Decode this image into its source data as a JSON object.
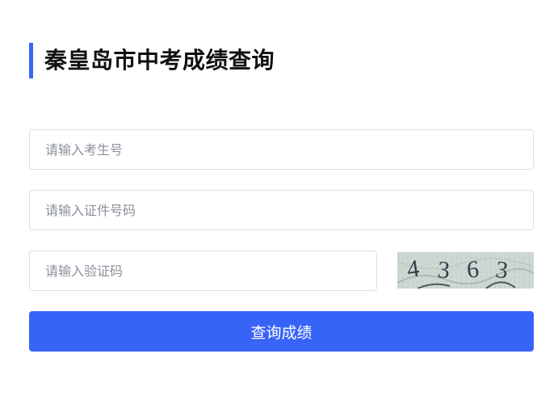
{
  "page": {
    "title": "秦皇岛市中考成绩查询"
  },
  "form": {
    "exam_number_placeholder": "请输入考生号",
    "id_number_placeholder": "请输入证件号码",
    "captcha_placeholder": "请输入验证码",
    "captcha_digits": [
      "4",
      "3",
      "6",
      "3"
    ],
    "submit_label": "查询成绩"
  },
  "colors": {
    "accent": "#3a66f5",
    "button": "#3863f7"
  }
}
